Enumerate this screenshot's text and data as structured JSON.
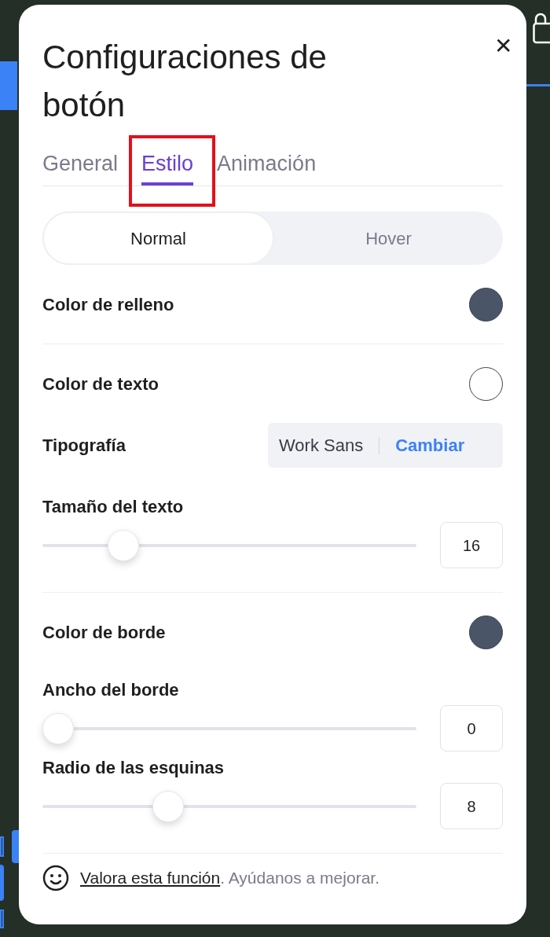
{
  "dialog": {
    "title": "Configuraciones de botón",
    "close": "✕"
  },
  "tabs": [
    {
      "label": "General",
      "selected": false,
      "highlighted": false
    },
    {
      "label": "Estilo",
      "selected": true,
      "highlighted": true
    },
    {
      "label": "Animación",
      "selected": false,
      "highlighted": false
    }
  ],
  "state_toggle": [
    {
      "label": "Normal",
      "selected": true
    },
    {
      "label": "Hover",
      "selected": false
    }
  ],
  "settings": [
    {
      "kind": "color",
      "label": "Color de relleno",
      "color": "#4a5568",
      "divider_below": true
    },
    {
      "kind": "color",
      "label": "Color de texto",
      "color": "#ffffff",
      "divider_below": false
    },
    {
      "kind": "font",
      "label": "Tipografía",
      "value": "Work Sans",
      "action": "Cambiar",
      "divider_below": false
    },
    {
      "kind": "slider",
      "label": "Tamaño del texto",
      "level": 0.19,
      "value": "16",
      "divider_below": true
    },
    {
      "kind": "color",
      "label": "Color de borde",
      "color": "#4a5568",
      "divider_below": false
    },
    {
      "kind": "slider",
      "label": "Ancho del borde",
      "level": 0,
      "value": "0",
      "divider_below": false
    },
    {
      "kind": "slider",
      "label": "Radio de las esquinas",
      "level": 0.32,
      "value": "8",
      "divider_below": true
    }
  ],
  "footer": {
    "link": "Valora esta función",
    "text": ". Ayúdanos a mejorar."
  }
}
